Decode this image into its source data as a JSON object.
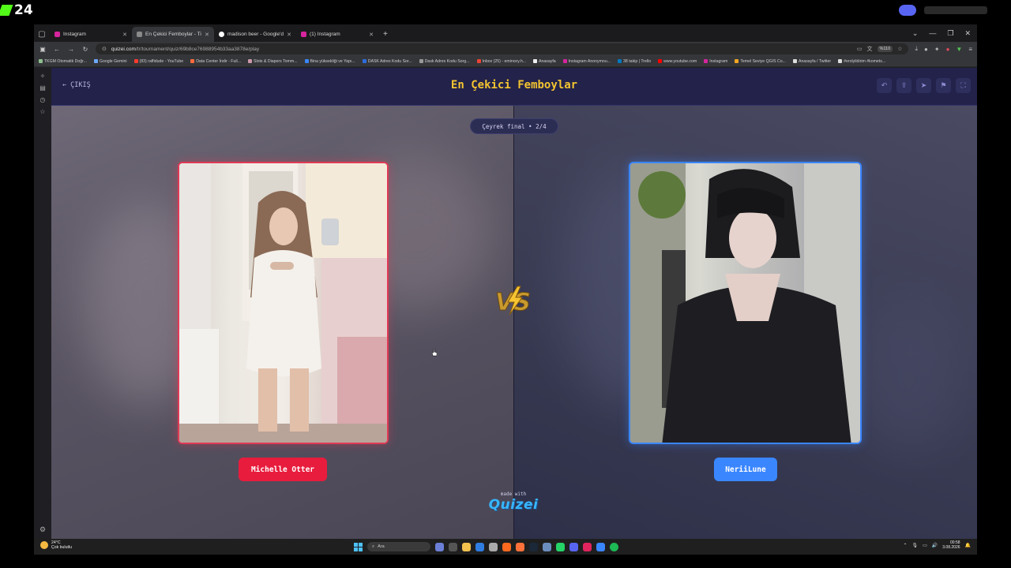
{
  "stream": {
    "counter": "24"
  },
  "browser": {
    "tabs": [
      {
        "title": "Instagram",
        "color": "#d6249f",
        "active": false
      },
      {
        "title": "En Çekici Femboylar - Tier List...",
        "color": "#8a8a8a",
        "active": true
      },
      {
        "title": "madison beer - Google'da Ara",
        "color": "#ffffff",
        "active": false
      },
      {
        "title": "(1) Instagram",
        "color": "#d6249f",
        "active": false
      }
    ],
    "url_host": "quizei.com",
    "url_path": "/tr/tournament/quiz/69b8ce76988954b33aa3878e/play",
    "zoom": "%110",
    "bookmarks": [
      {
        "label": "TKGM Otomatik Doğr...",
        "color": "#8fbf8f"
      },
      {
        "label": "Google Gemini",
        "color": "#6ea8ff"
      },
      {
        "label": "(83) raffidude - YouTube",
        "color": "#ff3b30"
      },
      {
        "label": "Data Center İndir - Fuil...",
        "color": "#ff6b3d"
      },
      {
        "label": "Slots & Diapers Tomm...",
        "color": "#c9a"
      },
      {
        "label": "Bina yüksekliği ve Yapı...",
        "color": "#3a86ff"
      },
      {
        "label": "DASK Adres Kodu Sor...",
        "color": "#2d6cdf"
      },
      {
        "label": "Dask Adres Kodu Sorg...",
        "color": "#999"
      },
      {
        "label": "Inbox (25) - emincey.h...",
        "color": "#ea4335"
      },
      {
        "label": "Anasayfa",
        "color": "#eee"
      },
      {
        "label": "Instagram Anonymou...",
        "color": "#d6249f"
      },
      {
        "label": "38 takip | Trello",
        "color": "#0079bf"
      },
      {
        "label": "www.youtube.com",
        "color": "#ff0000"
      },
      {
        "label": "Instagram",
        "color": "#d6249f"
      },
      {
        "label": "Temel Seviye QGIS Co...",
        "color": "#f5a623"
      },
      {
        "label": "Anasayfa / Twitter",
        "color": "#ddd"
      },
      {
        "label": "#erolyildirim #komets...",
        "color": "#ddd"
      }
    ]
  },
  "quiz": {
    "back_label": "ÇIKIŞ",
    "title": "En Çekici Femboylar",
    "round": "Çeyrek final • 2/4",
    "vs_label": "VS",
    "left_contestant": "Michelle Otter",
    "right_contestant": "NeriiLune",
    "made_with": "made with",
    "brand": "Quizei",
    "colors": {
      "left": "#e81c3d",
      "right": "#3a86ff",
      "title": "#f4c430"
    }
  },
  "taskbar": {
    "temp": "24°C",
    "weather": "Çok bulutlu",
    "search": "Ara",
    "time": "00:58",
    "date": "3.08.2026"
  }
}
